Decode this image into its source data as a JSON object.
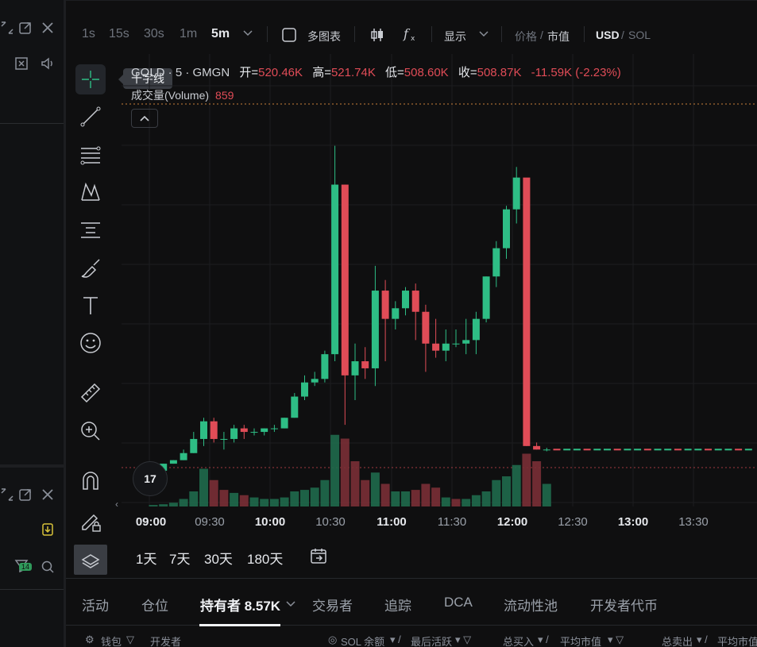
{
  "toolbar": {
    "timeframes": [
      "1s",
      "15s",
      "30s",
      "1m",
      "5m"
    ],
    "active_timeframe": "5m",
    "multi_chart_label": "多图表",
    "display_label": "显示",
    "price_label": "价格",
    "mcap_label": "市值",
    "usd_label": "USD",
    "sol_label": "SOL"
  },
  "legend": {
    "symbol": "GOLD · 5 · GMGN",
    "open_label": "开=",
    "open": "520.46K",
    "high_label": "高=",
    "high": "521.74K",
    "low_label": "低=",
    "low": "508.60K",
    "close_label": "收=",
    "close": "508.87K",
    "change": "-11.59K (-2.23%)",
    "volume_label": "成交量(Volume)",
    "volume": "859"
  },
  "tooltip": "十字线",
  "tv_logo": "17",
  "range_buttons": [
    "1天",
    "7天",
    "30天",
    "180天"
  ],
  "tabs": [
    "活动",
    "仓位",
    "持有者 8.57K",
    "交易者",
    "追踪",
    "DCA",
    "流动性池",
    "开发者代币"
  ],
  "active_tab": "持有者 8.57K",
  "table_header": {
    "wallet": "钱包",
    "developer": "开发者",
    "sol_balance": "SOL 余额",
    "last_active": "最后活跃",
    "total_bought": "总买入",
    "avg_mcap": "平均市值",
    "total_sold": "总卖出",
    "avg_mcap2": "平均市值"
  },
  "left_panel": {
    "badge": "14"
  },
  "colors": {
    "up": "#2ebd85",
    "down": "#e04c57",
    "bg": "#0f0f10"
  },
  "chart_data": {
    "type": "candlestick",
    "x_ticks": [
      "09:00",
      "09:30",
      "10:00",
      "10:30",
      "11:00",
      "11:30",
      "12:00",
      "12:30",
      "13:00",
      "13:30"
    ],
    "x_ticks_bold": [
      "09:00",
      "10:00",
      "11:00",
      "12:00",
      "13:00"
    ],
    "interval": "5m",
    "candles_ohlc_relative": [
      [
        0.0,
        0.0,
        0.0,
        0.0
      ],
      [
        0.0,
        0.02,
        0.0,
        0.02
      ],
      [
        0.02,
        0.03,
        0.02,
        0.03
      ],
      [
        0.03,
        0.06,
        0.03,
        0.05
      ],
      [
        0.05,
        0.11,
        0.05,
        0.09
      ],
      [
        0.09,
        0.15,
        0.07,
        0.14
      ],
      [
        0.14,
        0.15,
        0.08,
        0.09
      ],
      [
        0.09,
        0.11,
        0.06,
        0.09
      ],
      [
        0.09,
        0.13,
        0.08,
        0.12
      ],
      [
        0.12,
        0.13,
        0.09,
        0.11
      ],
      [
        0.11,
        0.12,
        0.1,
        0.11
      ],
      [
        0.11,
        0.12,
        0.1,
        0.12
      ],
      [
        0.12,
        0.13,
        0.11,
        0.12
      ],
      [
        0.12,
        0.15,
        0.12,
        0.15
      ],
      [
        0.15,
        0.22,
        0.15,
        0.21
      ],
      [
        0.21,
        0.27,
        0.2,
        0.25
      ],
      [
        0.25,
        0.28,
        0.24,
        0.26
      ],
      [
        0.26,
        0.34,
        0.25,
        0.33
      ],
      [
        0.33,
        0.92,
        0.31,
        0.81
      ],
      [
        0.81,
        0.81,
        0.13,
        0.27
      ],
      [
        0.27,
        0.36,
        0.2,
        0.31
      ],
      [
        0.31,
        0.35,
        0.26,
        0.29
      ],
      [
        0.29,
        0.58,
        0.24,
        0.51
      ],
      [
        0.51,
        0.54,
        0.31,
        0.43
      ],
      [
        0.43,
        0.48,
        0.4,
        0.46
      ],
      [
        0.46,
        0.52,
        0.44,
        0.51
      ],
      [
        0.51,
        0.53,
        0.37,
        0.45
      ],
      [
        0.45,
        0.47,
        0.28,
        0.36
      ],
      [
        0.36,
        0.43,
        0.32,
        0.34
      ],
      [
        0.34,
        0.4,
        0.31,
        0.36
      ],
      [
        0.36,
        0.4,
        0.35,
        0.36
      ],
      [
        0.36,
        0.43,
        0.33,
        0.37
      ],
      [
        0.37,
        0.45,
        0.33,
        0.43
      ],
      [
        0.43,
        0.55,
        0.42,
        0.55
      ],
      [
        0.55,
        0.65,
        0.52,
        0.63
      ],
      [
        0.63,
        0.75,
        0.6,
        0.74
      ],
      [
        0.74,
        0.86,
        0.7,
        0.83
      ],
      [
        0.83,
        0.73,
        0.07,
        0.07
      ],
      [
        0.07,
        0.08,
        0.06,
        0.06
      ],
      [
        0.06,
        0.065,
        0.055,
        0.06
      ]
    ],
    "volume_relative": [
      0.02,
      0.03,
      0.05,
      0.1,
      0.2,
      0.5,
      0.35,
      0.22,
      0.18,
      0.15,
      0.12,
      0.1,
      0.1,
      0.12,
      0.2,
      0.22,
      0.25,
      0.35,
      0.95,
      0.9,
      0.6,
      0.35,
      0.45,
      0.3,
      0.2,
      0.2,
      0.22,
      0.3,
      0.25,
      0.12,
      0.1,
      0.1,
      0.15,
      0.2,
      0.35,
      0.4,
      0.55,
      0.7,
      0.6,
      0.3
    ],
    "volume_down_flags": [
      0,
      0,
      0,
      0,
      0,
      0,
      1,
      1,
      0,
      1,
      0,
      0,
      0,
      0,
      0,
      0,
      0,
      0,
      0,
      1,
      1,
      1,
      0,
      1,
      0,
      0,
      1,
      1,
      1,
      0,
      1,
      0,
      0,
      0,
      0,
      0,
      0,
      1,
      1,
      0
    ]
  }
}
